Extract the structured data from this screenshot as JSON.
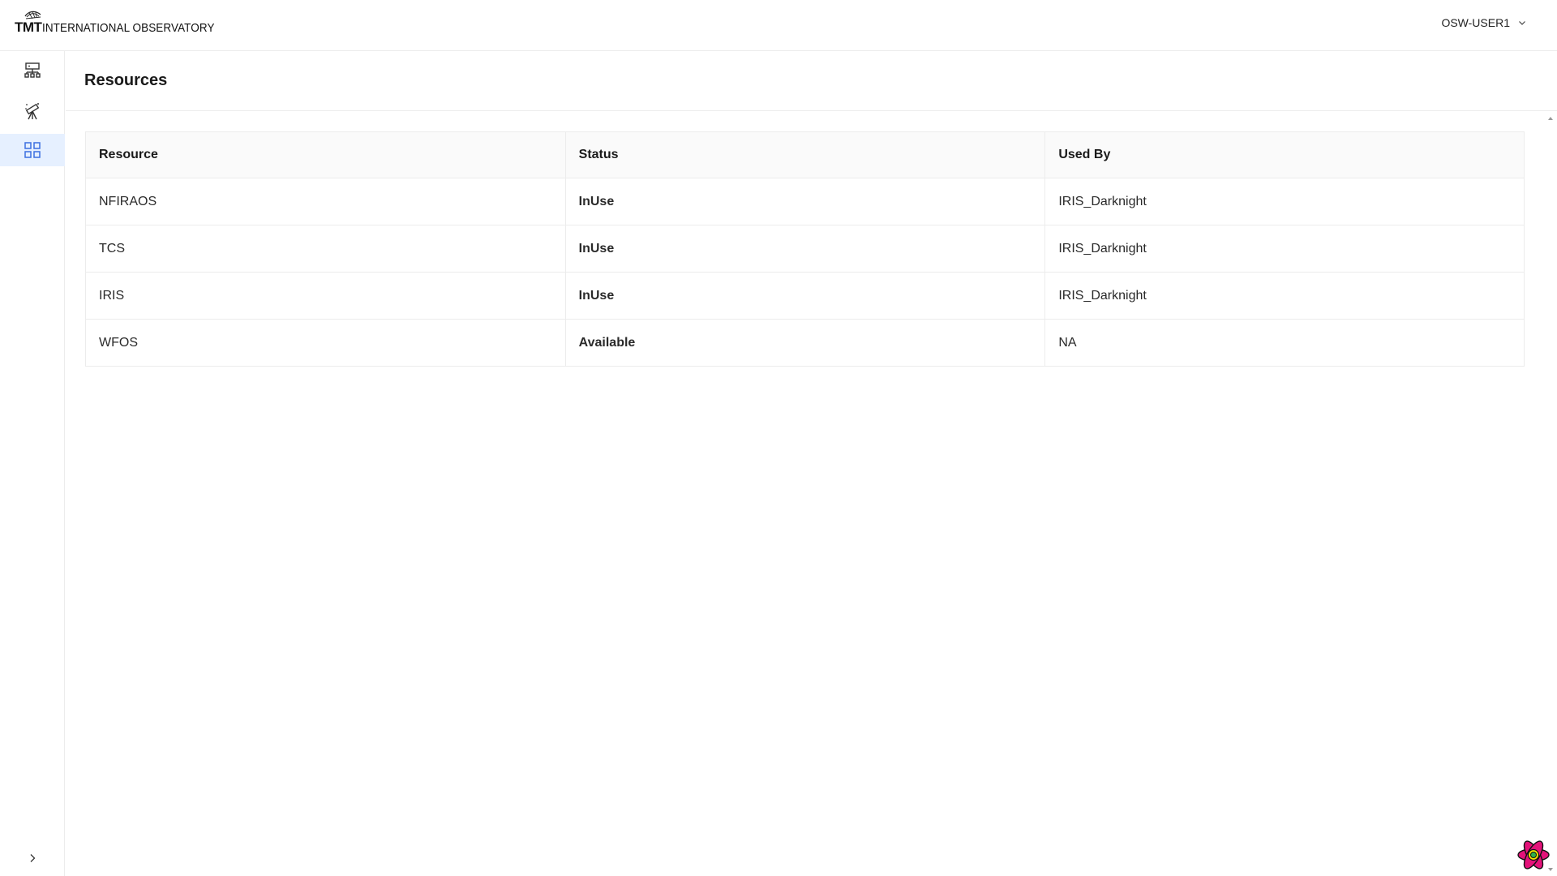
{
  "header": {
    "logo_mark": "TMT",
    "logo_text": "INTERNATIONAL OBSERVATORY",
    "user": "OSW-USER1"
  },
  "sidebar": {
    "items": [
      {
        "icon": "hierarchy-icon",
        "active": false
      },
      {
        "icon": "telescope-icon",
        "active": false
      },
      {
        "icon": "grid-icon",
        "active": true
      }
    ],
    "toggle_icon": "chevron-right-icon"
  },
  "page": {
    "title": "Resources"
  },
  "table": {
    "columns": [
      "Resource",
      "Status",
      "Used By"
    ],
    "rows": [
      {
        "resource": "NFIRAOS",
        "status": "InUse",
        "used_by": "IRIS_Darknight"
      },
      {
        "resource": "TCS",
        "status": "InUse",
        "used_by": "IRIS_Darknight"
      },
      {
        "resource": "IRIS",
        "status": "InUse",
        "used_by": "IRIS_Darknight"
      },
      {
        "resource": "WFOS",
        "status": "Available",
        "used_by": "NA"
      }
    ]
  },
  "colors": {
    "inuse": "#22c51e",
    "available": "#9a12cf",
    "active_nav_bg": "#e6f0ff",
    "accent": "#3b6fe0"
  }
}
